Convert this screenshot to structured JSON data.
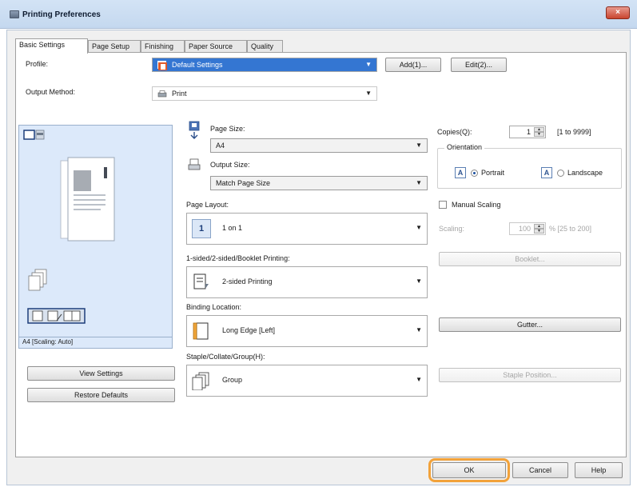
{
  "window": {
    "title": "Printing Preferences",
    "close_label": "×"
  },
  "tabs": [
    "Basic Settings",
    "Page Setup",
    "Finishing",
    "Paper Source",
    "Quality"
  ],
  "profile": {
    "label": "Profile:",
    "value": "Default Settings",
    "add_label": "Add(1)...",
    "edit_label": "Edit(2)..."
  },
  "output_method": {
    "label": "Output Method:",
    "value": "Print"
  },
  "preview": {
    "status": "A4 [Scaling: Auto]"
  },
  "left_buttons": {
    "view_settings": "View Settings",
    "restore_defaults": "Restore Defaults"
  },
  "page_size": {
    "label": "Page Size:",
    "value": "A4"
  },
  "output_size": {
    "label": "Output Size:",
    "value": "Match Page Size"
  },
  "page_layout": {
    "label": "Page Layout:",
    "value": "1 on 1",
    "icon_text": "1"
  },
  "sided": {
    "label": "1-sided/2-sided/Booklet Printing:",
    "value": "2-sided Printing"
  },
  "binding": {
    "label": "Binding Location:",
    "value": "Long Edge [Left]"
  },
  "staple": {
    "label": "Staple/Collate/Group(H):",
    "value": "Group"
  },
  "copies": {
    "label": "Copies(Q):",
    "value": "1",
    "range": "[1 to 9999]"
  },
  "orientation": {
    "label": "Orientation",
    "portrait": "Portrait",
    "landscape": "Landscape",
    "selected": "Portrait",
    "icon_text": "A"
  },
  "manual_scaling": {
    "label": "Manual Scaling",
    "checked": false
  },
  "scaling": {
    "label": "Scaling:",
    "value": "100",
    "range": "% [25 to 200]"
  },
  "side_buttons": {
    "booklet": "Booklet...",
    "gutter": "Gutter...",
    "staple_position": "Staple Position..."
  },
  "footer": {
    "ok": "OK",
    "cancel": "Cancel",
    "help": "Help"
  },
  "colors": {
    "accent": "#3476d2",
    "highlight": "#f2a23a",
    "preview_bg": "#dce9fa"
  }
}
